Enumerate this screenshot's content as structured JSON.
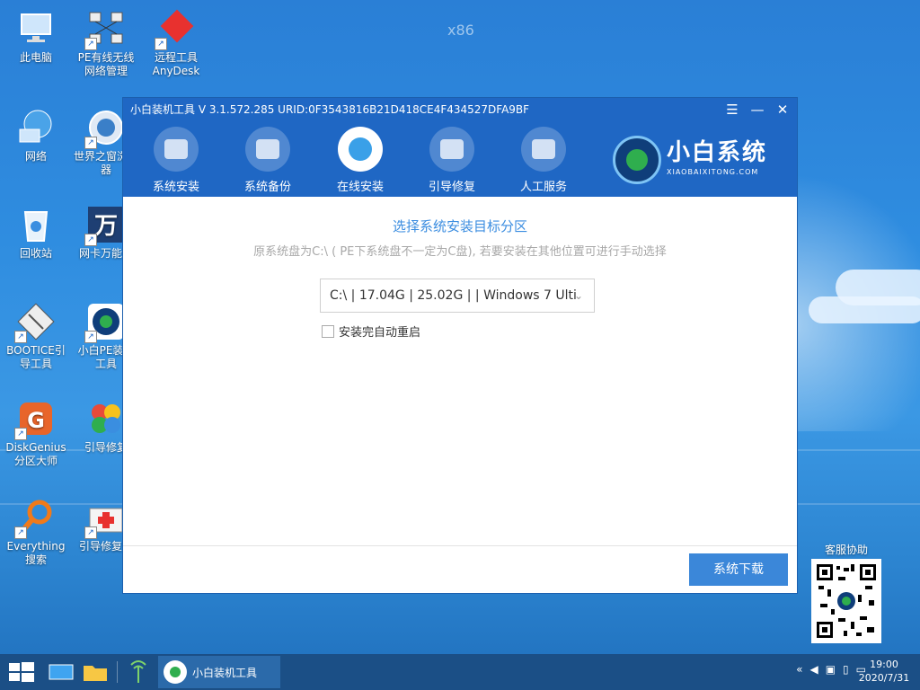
{
  "desktop": {
    "arch_label": "x86",
    "icons": [
      {
        "label": "此电脑"
      },
      {
        "label": "PE有线无线网络管理"
      },
      {
        "label": "远程工具AnyDesk"
      },
      {
        "label": "网络"
      },
      {
        "label": "世界之窗浏览器"
      },
      {
        "label": "回收站"
      },
      {
        "label": "网卡万能驱"
      },
      {
        "label": "BOOTICE引导工具"
      },
      {
        "label": "小白PE装机工具"
      },
      {
        "label": "DiskGenius分区大师"
      },
      {
        "label": "引导修复"
      },
      {
        "label": "Everything搜索"
      },
      {
        "label": "引导修复工"
      }
    ]
  },
  "window": {
    "title": "小白装机工具 V 3.1.572.285 URID:0F3543816B21D418CE4F434527DFA9BF",
    "controls": {
      "menu": "☰",
      "minimize": "—",
      "close": "✕"
    },
    "nav": [
      {
        "label": "系统安装",
        "active": false
      },
      {
        "label": "系统备份",
        "active": false
      },
      {
        "label": "在线安装",
        "active": true
      },
      {
        "label": "引导修复",
        "active": false
      },
      {
        "label": "人工服务",
        "active": false
      }
    ],
    "brand": {
      "name": "小白系统",
      "sub": "XIAOBAIXITONG.COM"
    },
    "heading": "选择系统安装目标分区",
    "hint": "原系统盘为C:\\ ( PE下系统盘不一定为C盘), 若要安装在其他位置可进行手动选择",
    "partition_select": {
      "value": "C:\\ | 17.04G | 25.02G |  | Windows 7 Ulti"
    },
    "auto_restart": {
      "label": "安装完自动重启",
      "checked": false
    },
    "download_button": "系统下载"
  },
  "qr": {
    "label": "客服协助"
  },
  "taskbar": {
    "app_label": "小白装机工具",
    "time": "19:00",
    "date": "2020/7/31"
  },
  "colors": {
    "accent": "#1f67c4",
    "button": "#3b87d9",
    "heading": "#3b8de0"
  }
}
